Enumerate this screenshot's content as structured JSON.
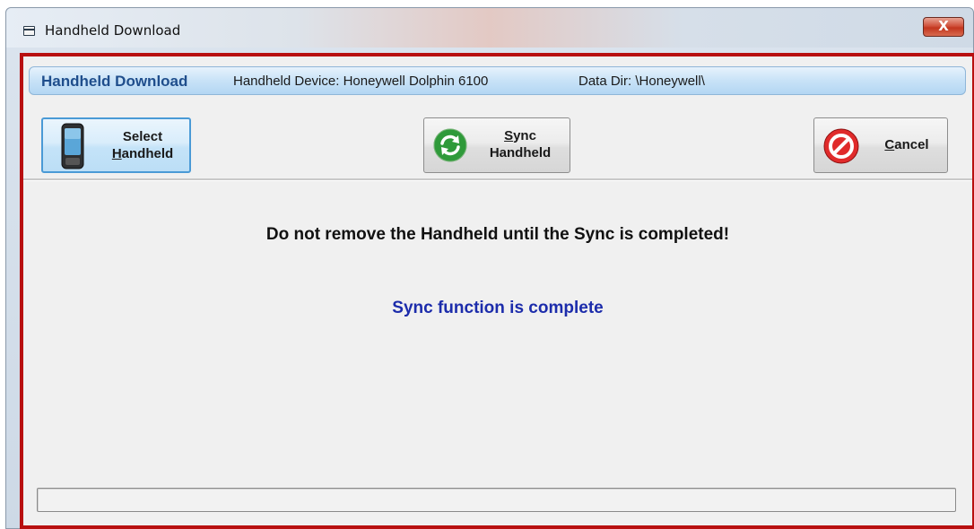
{
  "window": {
    "title": "Handheld Download",
    "close_glyph": "X"
  },
  "info_bar": {
    "title": "Handheld Download",
    "device": "Handheld Device:  Honeywell Dolphin 6100",
    "data_dir": "Data Dir:  \\Honeywell\\"
  },
  "toolbar": {
    "select": {
      "line1": "Select",
      "line2_accel": "H",
      "line2_rest": "andheld",
      "icon": "handheld-device-icon"
    },
    "sync": {
      "line1_accel": "S",
      "line1_rest": "ync",
      "line2": "Handheld",
      "icon": "sync-icon"
    },
    "cancel": {
      "accel": "C",
      "rest": "ancel",
      "icon": "cancel-icon"
    }
  },
  "messages": {
    "warning": "Do not remove the Handheld until the Sync is completed!",
    "status": "Sync function is complete"
  },
  "progress": {
    "percent": 0
  },
  "colors": {
    "frame": "#b81010",
    "status_text": "#1c2cab",
    "info_title": "#1f4e8c"
  }
}
